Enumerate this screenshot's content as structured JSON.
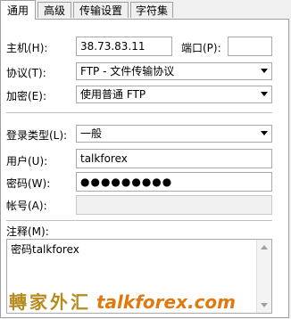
{
  "tabs": [
    {
      "label": "通用"
    },
    {
      "label": "高级"
    },
    {
      "label": "传输设置"
    },
    {
      "label": "字符集"
    }
  ],
  "form": {
    "host_label": "主机(H):",
    "host_value": "38.73.83.11",
    "port_label": "端口(P):",
    "port_value": "",
    "protocol_label": "协议(T):",
    "protocol_value": "FTP - 文件传输协议",
    "encryption_label": "加密(E):",
    "encryption_value": "使用普通 FTP",
    "logon_type_label": "登录类型(L):",
    "logon_type_value": "一般",
    "user_label": "用户(U):",
    "user_value": "talkforex",
    "password_label": "密码(W):",
    "password_value": "●●●●●●●●●",
    "account_label": "帐号(A):",
    "account_value": "",
    "comments_label": "注释(M):",
    "comments_value": "密码talkforex"
  },
  "watermark": {
    "chinese": "轉家外汇",
    "english": "talkforex.com"
  }
}
